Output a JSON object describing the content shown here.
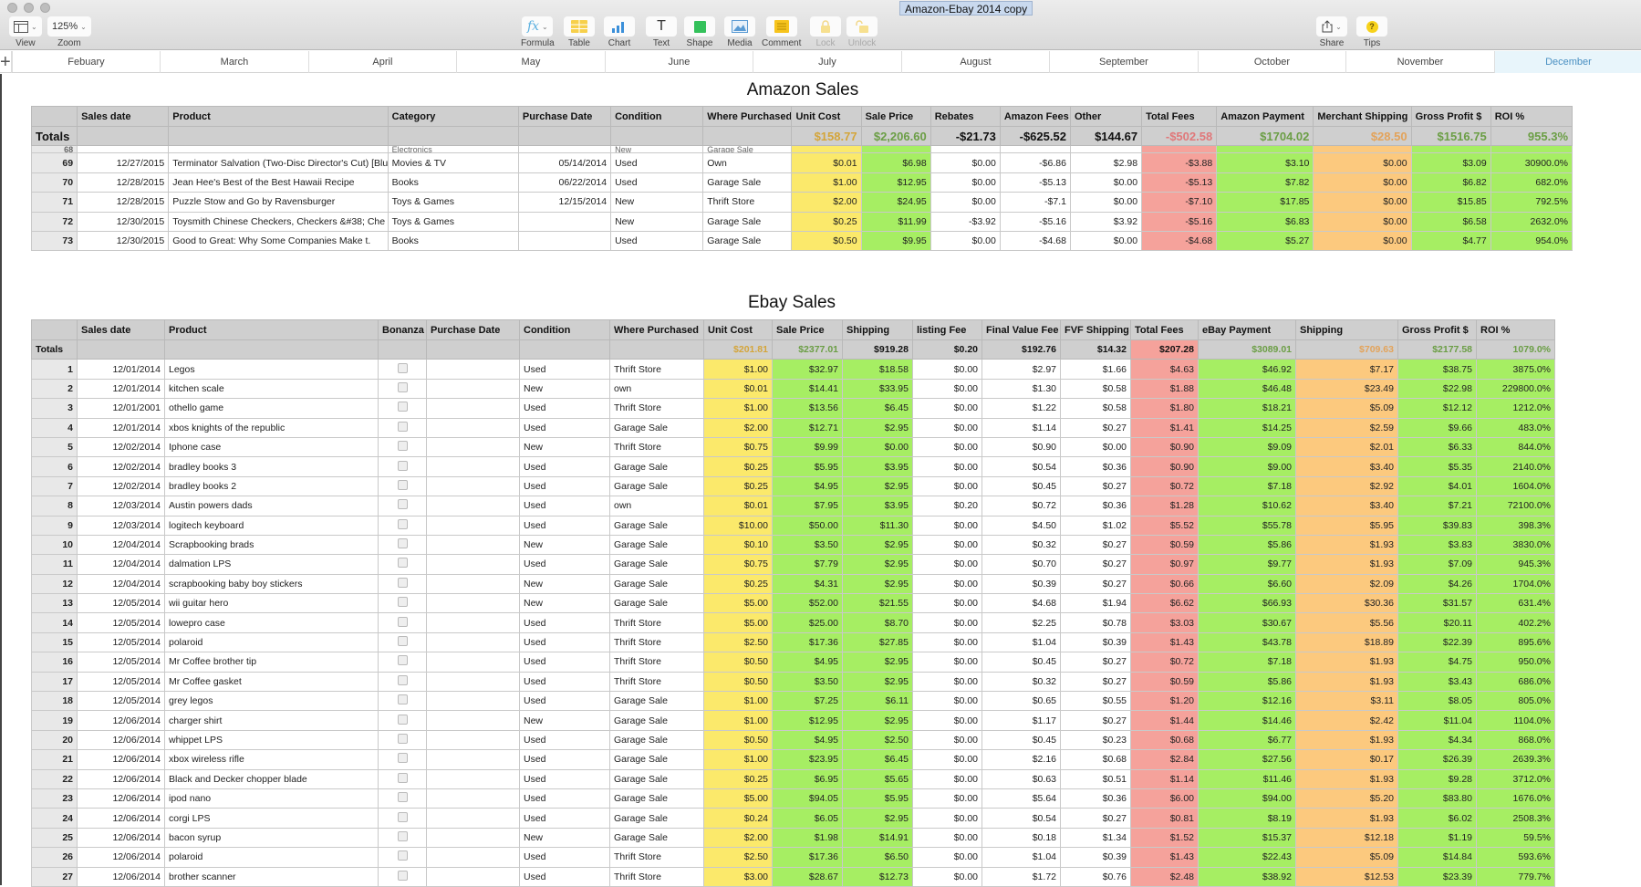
{
  "window": {
    "title": "Amazon-Ebay 2014 copy"
  },
  "toolbar": {
    "view": {
      "label": "View",
      "icon": "sidebar-view-icon"
    },
    "zoom": {
      "label": "Zoom",
      "value": "125%"
    },
    "insert": [
      {
        "label": "Formula",
        "icon": "fx-icon",
        "glyph": "fx"
      },
      {
        "label": "Table",
        "icon": "table-icon"
      },
      {
        "label": "Chart",
        "icon": "bar-chart-icon"
      },
      {
        "label": "Text",
        "icon": "text-icon",
        "glyph": "T"
      },
      {
        "label": "Shape",
        "icon": "shape-icon"
      },
      {
        "label": "Media",
        "icon": "image-icon"
      },
      {
        "label": "Comment",
        "icon": "comment-icon"
      },
      {
        "label": "Lock",
        "icon": "lock-icon",
        "disabled": true
      },
      {
        "label": "Unlock",
        "icon": "unlock-icon",
        "disabled": true
      }
    ],
    "share": {
      "label": "Share",
      "icon": "share-icon"
    },
    "tips": {
      "label": "Tips",
      "icon": "help-icon",
      "glyph": "?"
    }
  },
  "sheets": {
    "add_icon": "+",
    "tabs": [
      "Febuary",
      "March",
      "April",
      "May",
      "June",
      "July",
      "August",
      "September",
      "October",
      "November",
      "December"
    ],
    "active": "December"
  },
  "amazon": {
    "title": "Amazon Sales",
    "columns": [
      "",
      "Sales date",
      "Product",
      "Category",
      "Purchase Date",
      "Condition",
      "Where Purchased",
      "Unit Cost",
      "Sale Price",
      "Rebates",
      "Amazon Fees",
      "Other",
      "Total Fees",
      "Amazon Payment",
      "Merchant Shipping",
      "Gross Profit $",
      "ROI %"
    ],
    "totals_label": "Totals",
    "totals": {
      "unit_cost": "$158.77",
      "sale_price": "$2,206.60",
      "rebates": "-$21.73",
      "amazon_fees": "-$625.52",
      "other": "$144.67",
      "total_fees": "-$502.58",
      "amazon_payment": "$1704.02",
      "merchant_shipping": "$28.50",
      "gross_profit": "$1516.75",
      "roi": "955.3%"
    },
    "clipped_row": {
      "num": "68",
      "category": "Electronics",
      "condition": "New",
      "where": "Garage Sale"
    },
    "rows": [
      {
        "num": "69",
        "date": "12/27/2015",
        "product": "Terminator Salvation (Two-Disc Director's Cut) [Blu",
        "category": "Movies & TV",
        "purchase_date": "05/14/2014",
        "condition": "Used",
        "where": "Own",
        "unit_cost": "$0.01",
        "sale_price": "$6.98",
        "rebates": "$0.00",
        "amazon_fees": "-$6.86",
        "other": "$2.98",
        "total_fees": "-$3.88",
        "payment": "$3.10",
        "shipping": "$0.00",
        "profit": "$3.09",
        "roi": "30900.0%"
      },
      {
        "num": "70",
        "date": "12/28/2015",
        "product": "Jean Hee's Best of the Best Hawaii Recipe",
        "category": "Books",
        "purchase_date": "06/22/2014",
        "condition": "Used",
        "where": "Garage Sale",
        "unit_cost": "$1.00",
        "sale_price": "$12.95",
        "rebates": "$0.00",
        "amazon_fees": "-$5.13",
        "other": "$0.00",
        "total_fees": "-$5.13",
        "payment": "$7.82",
        "shipping": "$0.00",
        "profit": "$6.82",
        "roi": "682.0%"
      },
      {
        "num": "71",
        "date": "12/28/2015",
        "product": "Puzzle Stow and Go by Ravensburger",
        "category": "Toys & Games",
        "purchase_date": "12/15/2014",
        "condition": "New",
        "where": "Thrift Store",
        "unit_cost": "$2.00",
        "sale_price": "$24.95",
        "rebates": "$0.00",
        "amazon_fees": "-$7.1",
        "other": "$0.00",
        "total_fees": "-$7.10",
        "payment": "$17.85",
        "shipping": "$0.00",
        "profit": "$15.85",
        "roi": "792.5%"
      },
      {
        "num": "72",
        "date": "12/30/2015",
        "product": "Toysmith Chinese Checkers, Checkers &#38; Che",
        "category": "Toys & Games",
        "purchase_date": "",
        "condition": "New",
        "where": "Garage Sale",
        "unit_cost": "$0.25",
        "sale_price": "$11.99",
        "rebates": "-$3.92",
        "amazon_fees": "-$5.16",
        "other": "$3.92",
        "total_fees": "-$5.16",
        "payment": "$6.83",
        "shipping": "$0.00",
        "profit": "$6.58",
        "roi": "2632.0%"
      },
      {
        "num": "73",
        "date": "12/30/2015",
        "product": "Good to Great: Why Some Companies Make t.",
        "category": "Books",
        "purchase_date": "",
        "condition": "Used",
        "where": "Garage Sale",
        "unit_cost": "$0.50",
        "sale_price": "$9.95",
        "rebates": "$0.00",
        "amazon_fees": "-$4.68",
        "other": "$0.00",
        "total_fees": "-$4.68",
        "payment": "$5.27",
        "shipping": "$0.00",
        "profit": "$4.77",
        "roi": "954.0%"
      }
    ]
  },
  "ebay": {
    "title": "Ebay Sales",
    "columns": [
      "",
      "Sales date",
      "Product",
      "Bonanza",
      "Purchase Date",
      "Condition",
      "Where Purchased",
      "Unit Cost",
      "Sale Price",
      "Shipping",
      "listing Fee",
      "Final Value Fee",
      "FVF Shipping",
      "Total Fees",
      "eBay Payment",
      "Shipping",
      "Gross Profit $",
      "ROI %"
    ],
    "totals_label": "Totals",
    "totals": {
      "unit_cost": "$201.81",
      "sale_price": "$2377.01",
      "shipping": "$919.28",
      "listing_fee": "$0.20",
      "fvf": "$192.76",
      "fvf_shipping": "$14.32",
      "total_fees": "$207.28",
      "payment": "$3089.01",
      "ship_cost": "$709.63",
      "profit": "$2177.58",
      "roi": "1079.0%"
    },
    "rows": [
      {
        "num": "1",
        "date": "12/01/2014",
        "product": "Legos",
        "bonanza": false,
        "condition": "Used",
        "where": "Thrift Store",
        "unit_cost": "$1.00",
        "sale_price": "$32.97",
        "shipping": "$18.58",
        "listing_fee": "$0.00",
        "fvf": "$2.97",
        "fvf_shipping": "$1.66",
        "total_fees": "$4.63",
        "payment": "$46.92",
        "ship_cost": "$7.17",
        "profit": "$38.75",
        "roi": "3875.0%"
      },
      {
        "num": "2",
        "date": "12/01/2014",
        "product": "kitchen scale",
        "bonanza": false,
        "condition": "New",
        "where": "own",
        "unit_cost": "$0.01",
        "sale_price": "$14.41",
        "shipping": "$33.95",
        "listing_fee": "$0.00",
        "fvf": "$1.30",
        "fvf_shipping": "$0.58",
        "total_fees": "$1.88",
        "payment": "$46.48",
        "ship_cost": "$23.49",
        "profit": "$22.98",
        "roi": "229800.0%"
      },
      {
        "num": "3",
        "date": "12/01/2001",
        "product": "othello game",
        "bonanza": false,
        "condition": "Used",
        "where": "Thrift Store",
        "unit_cost": "$1.00",
        "sale_price": "$13.56",
        "shipping": "$6.45",
        "listing_fee": "$0.00",
        "fvf": "$1.22",
        "fvf_shipping": "$0.58",
        "total_fees": "$1.80",
        "payment": "$18.21",
        "ship_cost": "$5.09",
        "profit": "$12.12",
        "roi": "1212.0%"
      },
      {
        "num": "4",
        "date": "12/01/2014",
        "product": "xbos knights of the republic",
        "bonanza": false,
        "condition": "Used",
        "where": "Garage Sale",
        "unit_cost": "$2.00",
        "sale_price": "$12.71",
        "shipping": "$2.95",
        "listing_fee": "$0.00",
        "fvf": "$1.14",
        "fvf_shipping": "$0.27",
        "total_fees": "$1.41",
        "payment": "$14.25",
        "ship_cost": "$2.59",
        "profit": "$9.66",
        "roi": "483.0%"
      },
      {
        "num": "5",
        "date": "12/02/2014",
        "product": "Iphone case",
        "bonanza": false,
        "condition": "New",
        "where": "Thrift Store",
        "unit_cost": "$0.75",
        "sale_price": "$9.99",
        "shipping": "$0.00",
        "listing_fee": "$0.00",
        "fvf": "$0.90",
        "fvf_shipping": "$0.00",
        "total_fees": "$0.90",
        "payment": "$9.09",
        "ship_cost": "$2.01",
        "profit": "$6.33",
        "roi": "844.0%"
      },
      {
        "num": "6",
        "date": "12/02/2014",
        "product": "bradley books 3",
        "bonanza": false,
        "condition": "Used",
        "where": "Garage Sale",
        "unit_cost": "$0.25",
        "sale_price": "$5.95",
        "shipping": "$3.95",
        "listing_fee": "$0.00",
        "fvf": "$0.54",
        "fvf_shipping": "$0.36",
        "total_fees": "$0.90",
        "payment": "$9.00",
        "ship_cost": "$3.40",
        "profit": "$5.35",
        "roi": "2140.0%"
      },
      {
        "num": "7",
        "date": "12/02/2014",
        "product": "bradley books 2",
        "bonanza": false,
        "condition": "Used",
        "where": "Garage Sale",
        "unit_cost": "$0.25",
        "sale_price": "$4.95",
        "shipping": "$2.95",
        "listing_fee": "$0.00",
        "fvf": "$0.45",
        "fvf_shipping": "$0.27",
        "total_fees": "$0.72",
        "payment": "$7.18",
        "ship_cost": "$2.92",
        "profit": "$4.01",
        "roi": "1604.0%"
      },
      {
        "num": "8",
        "date": "12/03/2014",
        "product": "Austin powers dads",
        "bonanza": false,
        "condition": "Used",
        "where": "own",
        "unit_cost": "$0.01",
        "sale_price": "$7.95",
        "shipping": "$3.95",
        "listing_fee": "$0.20",
        "fvf": "$0.72",
        "fvf_shipping": "$0.36",
        "total_fees": "$1.28",
        "payment": "$10.62",
        "ship_cost": "$3.40",
        "profit": "$7.21",
        "roi": "72100.0%"
      },
      {
        "num": "9",
        "date": "12/03/2014",
        "product": "logitech keyboard",
        "bonanza": false,
        "condition": "Used",
        "where": "Garage Sale",
        "unit_cost": "$10.00",
        "sale_price": "$50.00",
        "shipping": "$11.30",
        "listing_fee": "$0.00",
        "fvf": "$4.50",
        "fvf_shipping": "$1.02",
        "total_fees": "$5.52",
        "payment": "$55.78",
        "ship_cost": "$5.95",
        "profit": "$39.83",
        "roi": "398.3%"
      },
      {
        "num": "10",
        "date": "12/04/2014",
        "product": "Scrapbooking brads",
        "bonanza": false,
        "condition": "New",
        "where": "Garage Sale",
        "unit_cost": "$0.10",
        "sale_price": "$3.50",
        "shipping": "$2.95",
        "listing_fee": "$0.00",
        "fvf": "$0.32",
        "fvf_shipping": "$0.27",
        "total_fees": "$0.59",
        "payment": "$5.86",
        "ship_cost": "$1.93",
        "profit": "$3.83",
        "roi": "3830.0%"
      },
      {
        "num": "11",
        "date": "12/04/2014",
        "product": "dalmation LPS",
        "bonanza": false,
        "condition": "Used",
        "where": "Garage Sale",
        "unit_cost": "$0.75",
        "sale_price": "$7.79",
        "shipping": "$2.95",
        "listing_fee": "$0.00",
        "fvf": "$0.70",
        "fvf_shipping": "$0.27",
        "total_fees": "$0.97",
        "payment": "$9.77",
        "ship_cost": "$1.93",
        "profit": "$7.09",
        "roi": "945.3%"
      },
      {
        "num": "12",
        "date": "12/04/2014",
        "product": "scrapbooking baby boy stickers",
        "bonanza": false,
        "condition": "New",
        "where": "Garage Sale",
        "unit_cost": "$0.25",
        "sale_price": "$4.31",
        "shipping": "$2.95",
        "listing_fee": "$0.00",
        "fvf": "$0.39",
        "fvf_shipping": "$0.27",
        "total_fees": "$0.66",
        "payment": "$6.60",
        "ship_cost": "$2.09",
        "profit": "$4.26",
        "roi": "1704.0%"
      },
      {
        "num": "13",
        "date": "12/05/2014",
        "product": "wii guitar hero",
        "bonanza": false,
        "condition": "New",
        "where": "Garage Sale",
        "unit_cost": "$5.00",
        "sale_price": "$52.00",
        "shipping": "$21.55",
        "listing_fee": "$0.00",
        "fvf": "$4.68",
        "fvf_shipping": "$1.94",
        "total_fees": "$6.62",
        "payment": "$66.93",
        "ship_cost": "$30.36",
        "profit": "$31.57",
        "roi": "631.4%"
      },
      {
        "num": "14",
        "date": "12/05/2014",
        "product": "lowepro case",
        "bonanza": false,
        "condition": "Used",
        "where": "Thrift Store",
        "unit_cost": "$5.00",
        "sale_price": "$25.00",
        "shipping": "$8.70",
        "listing_fee": "$0.00",
        "fvf": "$2.25",
        "fvf_shipping": "$0.78",
        "total_fees": "$3.03",
        "payment": "$30.67",
        "ship_cost": "$5.56",
        "profit": "$20.11",
        "roi": "402.2%"
      },
      {
        "num": "15",
        "date": "12/05/2014",
        "product": "polaroid",
        "bonanza": false,
        "condition": "Used",
        "where": "Thrift Store",
        "unit_cost": "$2.50",
        "sale_price": "$17.36",
        "shipping": "$27.85",
        "listing_fee": "$0.00",
        "fvf": "$1.04",
        "fvf_shipping": "$0.39",
        "total_fees": "$1.43",
        "payment": "$43.78",
        "ship_cost": "$18.89",
        "profit": "$22.39",
        "roi": "895.6%"
      },
      {
        "num": "16",
        "date": "12/05/2014",
        "product": "Mr Coffee brother tip",
        "bonanza": false,
        "condition": "Used",
        "where": "Thrift Store",
        "unit_cost": "$0.50",
        "sale_price": "$4.95",
        "shipping": "$2.95",
        "listing_fee": "$0.00",
        "fvf": "$0.45",
        "fvf_shipping": "$0.27",
        "total_fees": "$0.72",
        "payment": "$7.18",
        "ship_cost": "$1.93",
        "profit": "$4.75",
        "roi": "950.0%"
      },
      {
        "num": "17",
        "date": "12/05/2014",
        "product": "Mr Coffee gasket",
        "bonanza": false,
        "condition": "Used",
        "where": "Thrift Store",
        "unit_cost": "$0.50",
        "sale_price": "$3.50",
        "shipping": "$2.95",
        "listing_fee": "$0.00",
        "fvf": "$0.32",
        "fvf_shipping": "$0.27",
        "total_fees": "$0.59",
        "payment": "$5.86",
        "ship_cost": "$1.93",
        "profit": "$3.43",
        "roi": "686.0%"
      },
      {
        "num": "18",
        "date": "12/05/2014",
        "product": "grey legos",
        "bonanza": false,
        "condition": "Used",
        "where": "Garage Sale",
        "unit_cost": "$1.00",
        "sale_price": "$7.25",
        "shipping": "$6.11",
        "listing_fee": "$0.00",
        "fvf": "$0.65",
        "fvf_shipping": "$0.55",
        "total_fees": "$1.20",
        "payment": "$12.16",
        "ship_cost": "$3.11",
        "profit": "$8.05",
        "roi": "805.0%"
      },
      {
        "num": "19",
        "date": "12/06/2014",
        "product": "charger shirt",
        "bonanza": false,
        "condition": "New",
        "where": "Garage Sale",
        "unit_cost": "$1.00",
        "sale_price": "$12.95",
        "shipping": "$2.95",
        "listing_fee": "$0.00",
        "fvf": "$1.17",
        "fvf_shipping": "$0.27",
        "total_fees": "$1.44",
        "payment": "$14.46",
        "ship_cost": "$2.42",
        "profit": "$11.04",
        "roi": "1104.0%"
      },
      {
        "num": "20",
        "date": "12/06/2014",
        "product": "whippet LPS",
        "bonanza": false,
        "condition": "Used",
        "where": "Garage Sale",
        "unit_cost": "$0.50",
        "sale_price": "$4.95",
        "shipping": "$2.50",
        "listing_fee": "$0.00",
        "fvf": "$0.45",
        "fvf_shipping": "$0.23",
        "total_fees": "$0.68",
        "payment": "$6.77",
        "ship_cost": "$1.93",
        "profit": "$4.34",
        "roi": "868.0%"
      },
      {
        "num": "21",
        "date": "12/06/2014",
        "product": "xbox wireless rifle",
        "bonanza": false,
        "condition": "Used",
        "where": "Garage Sale",
        "unit_cost": "$1.00",
        "sale_price": "$23.95",
        "shipping": "$6.45",
        "listing_fee": "$0.00",
        "fvf": "$2.16",
        "fvf_shipping": "$0.68",
        "total_fees": "$2.84",
        "payment": "$27.56",
        "ship_cost": "$0.17",
        "profit": "$26.39",
        "roi": "2639.3%"
      },
      {
        "num": "22",
        "date": "12/06/2014",
        "product": "Black and Decker chopper blade",
        "bonanza": false,
        "condition": "Used",
        "where": "Garage Sale",
        "unit_cost": "$0.25",
        "sale_price": "$6.95",
        "shipping": "$5.65",
        "listing_fee": "$0.00",
        "fvf": "$0.63",
        "fvf_shipping": "$0.51",
        "total_fees": "$1.14",
        "payment": "$11.46",
        "ship_cost": "$1.93",
        "profit": "$9.28",
        "roi": "3712.0%"
      },
      {
        "num": "23",
        "date": "12/06/2014",
        "product": "ipod nano",
        "bonanza": false,
        "condition": "Used",
        "where": "Garage Sale",
        "unit_cost": "$5.00",
        "sale_price": "$94.05",
        "shipping": "$5.95",
        "listing_fee": "$0.00",
        "fvf": "$5.64",
        "fvf_shipping": "$0.36",
        "total_fees": "$6.00",
        "payment": "$94.00",
        "ship_cost": "$5.20",
        "profit": "$83.80",
        "roi": "1676.0%"
      },
      {
        "num": "24",
        "date": "12/06/2014",
        "product": "corgi LPS",
        "bonanza": false,
        "condition": "Used",
        "where": "Garage Sale",
        "unit_cost": "$0.24",
        "sale_price": "$6.05",
        "shipping": "$2.95",
        "listing_fee": "$0.00",
        "fvf": "$0.54",
        "fvf_shipping": "$0.27",
        "total_fees": "$0.81",
        "payment": "$8.19",
        "ship_cost": "$1.93",
        "profit": "$6.02",
        "roi": "2508.3%"
      },
      {
        "num": "25",
        "date": "12/06/2014",
        "product": "bacon syrup",
        "bonanza": false,
        "condition": "New",
        "where": "Garage Sale",
        "unit_cost": "$2.00",
        "sale_price": "$1.98",
        "shipping": "$14.91",
        "listing_fee": "$0.00",
        "fvf": "$0.18",
        "fvf_shipping": "$1.34",
        "total_fees": "$1.52",
        "payment": "$15.37",
        "ship_cost": "$12.18",
        "profit": "$1.19",
        "roi": "59.5%"
      },
      {
        "num": "26",
        "date": "12/06/2014",
        "product": "polaroid",
        "bonanza": false,
        "condition": "Used",
        "where": "Thrift Store",
        "unit_cost": "$2.50",
        "sale_price": "$17.36",
        "shipping": "$6.50",
        "listing_fee": "$0.00",
        "fvf": "$1.04",
        "fvf_shipping": "$0.39",
        "total_fees": "$1.43",
        "payment": "$22.43",
        "ship_cost": "$5.09",
        "profit": "$14.84",
        "roi": "593.6%"
      },
      {
        "num": "27",
        "date": "12/06/2014",
        "product": "brother scanner",
        "bonanza": false,
        "condition": "Used",
        "where": "Thrift Store",
        "unit_cost": "$3.00",
        "sale_price": "$28.67",
        "shipping": "$12.73",
        "listing_fee": "$0.00",
        "fvf": "$1.72",
        "fvf_shipping": "$0.76",
        "total_fees": "$2.48",
        "payment": "$38.92",
        "ship_cost": "$12.53",
        "profit": "$23.39",
        "roi": "779.7%"
      }
    ]
  }
}
